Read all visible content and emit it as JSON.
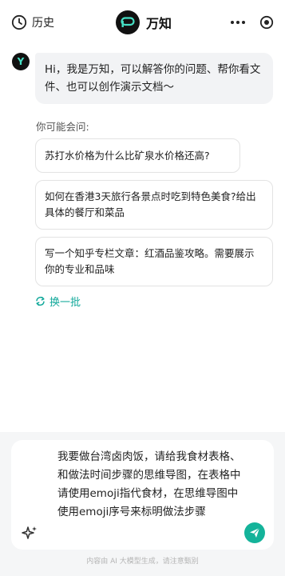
{
  "header": {
    "history_label": "历史",
    "brand_name": "万知",
    "history_icon": "clock-icon",
    "more_icon": "more-dots-icon",
    "target_icon": "target-icon"
  },
  "assistant": {
    "avatar_letter": "Y",
    "greeting": "Hi，我是万知，可以解答你的问题、帮你看文件、也可以创作演示文档～"
  },
  "suggestions": {
    "title": "你可能会问:",
    "items": [
      "苏打水价格为什么比矿泉水价格还高?",
      "如何在香港3天旅行各景点时吃到特色美食?给出具体的餐厅和菜品",
      "写一个知乎专栏文章：红酒品鉴攻略。需要展示你的专业和品味"
    ],
    "refresh_label": "换一批"
  },
  "composer": {
    "value": "我要做台湾卤肉饭，请给我食材表格、和做法时间步骤的思维导图，在表格中请使用emoji指代食材，在思维导图中使用emoji序号来标明做法步骤"
  },
  "footer": {
    "disclaimer": "内容由 AI 大模型生成，请注意甄别"
  },
  "colors": {
    "accent": "#14b39a",
    "bubble": "#f2f3f5",
    "composer_bg": "#f5f6f7"
  }
}
